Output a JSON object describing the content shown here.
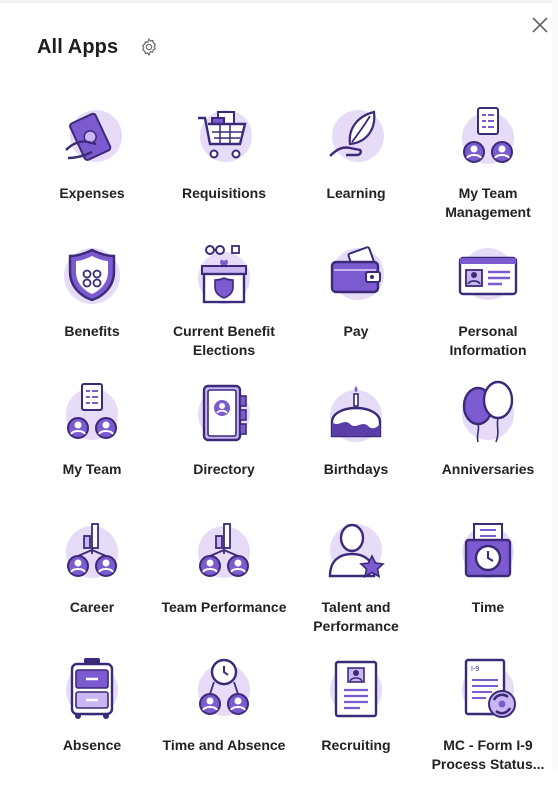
{
  "panel": {
    "title": "All Apps",
    "icons": {
      "settings": "gear-icon",
      "close": "close-icon"
    },
    "colors": {
      "icon_fill": "#e6dcf8",
      "icon_accent": "#7c5bd0",
      "icon_line": "#3b2a78",
      "text": "#222222"
    }
  },
  "apps": [
    {
      "label": "Expenses",
      "icon": "expenses-icon"
    },
    {
      "label": "Requisitions",
      "icon": "shopping-cart-icon"
    },
    {
      "label": "Learning",
      "icon": "leaf-hand-icon"
    },
    {
      "label": "My Team Management",
      "icon": "team-document-icon"
    },
    {
      "label": "Benefits",
      "icon": "shield-icon"
    },
    {
      "label": "Current Benefit Elections",
      "icon": "benefit-box-icon"
    },
    {
      "label": "Pay",
      "icon": "wallet-icon"
    },
    {
      "label": "Personal Information",
      "icon": "id-card-icon"
    },
    {
      "label": "My Team",
      "icon": "team-document-icon"
    },
    {
      "label": "Directory",
      "icon": "address-book-icon"
    },
    {
      "label": "Birthdays",
      "icon": "cake-icon"
    },
    {
      "label": "Anniversaries",
      "icon": "balloons-icon"
    },
    {
      "label": "Career",
      "icon": "team-chart-icon"
    },
    {
      "label": "Team Performance",
      "icon": "team-chart-icon"
    },
    {
      "label": "Talent and Performance",
      "icon": "person-star-icon"
    },
    {
      "label": "Time",
      "icon": "time-clock-icon"
    },
    {
      "label": "Absence",
      "icon": "suitcase-icon"
    },
    {
      "label": "Time and Absence",
      "icon": "team-clock-icon"
    },
    {
      "label": "Recruiting",
      "icon": "resume-icon"
    },
    {
      "label": "MC - Form I-9 Process Status...",
      "icon": "form-i9-icon"
    }
  ]
}
